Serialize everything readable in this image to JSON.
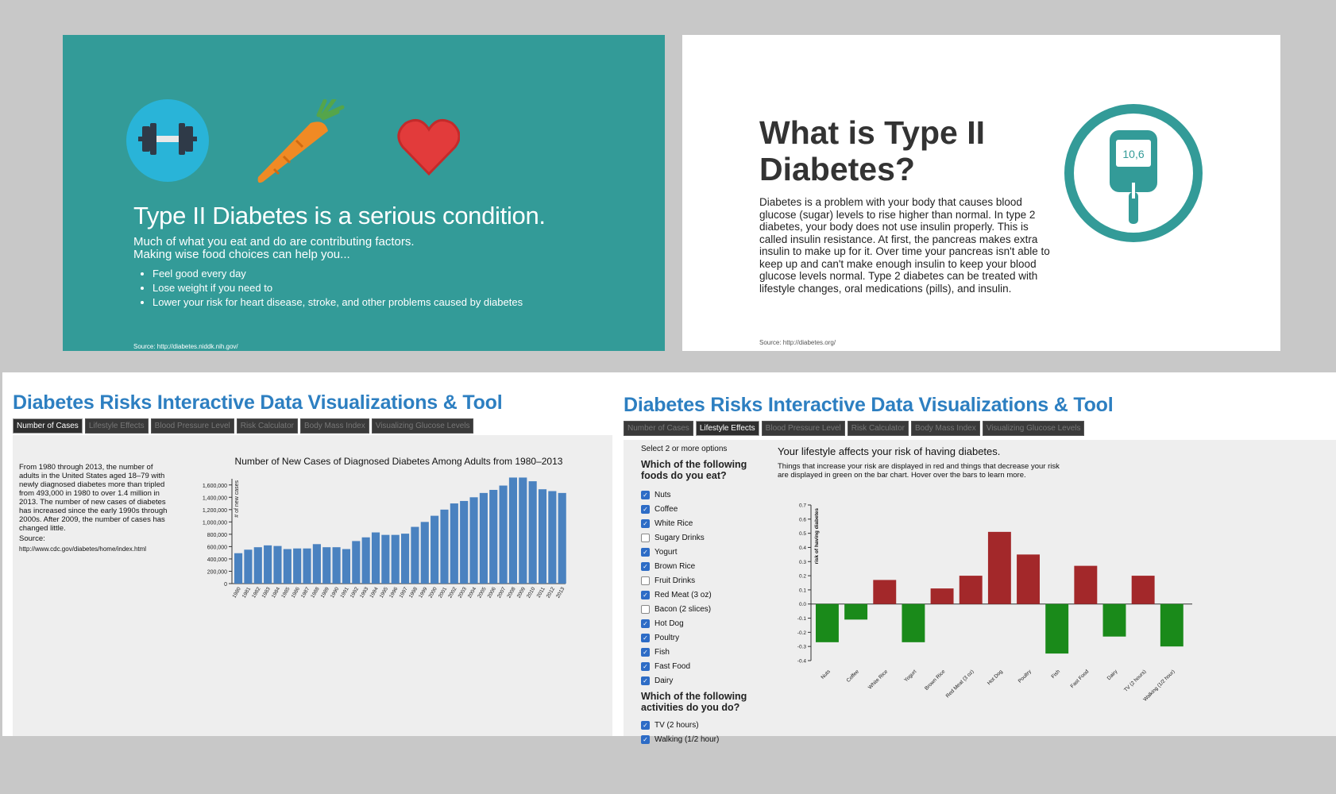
{
  "slide1": {
    "title": "Type II Diabetes is a serious condition.",
    "intro_line1": "Much of what you eat and do are contributing factors.",
    "intro_line2": "Making wise food choices can help you...",
    "bullets": [
      "Feel good every day",
      "Lose weight if you need to",
      "Lower your risk for heart disease, stroke, and other problems caused by diabetes"
    ],
    "source": "Source: http://diabetes.niddk.nih.gov/",
    "icons": [
      "dumbbell-icon",
      "carrot-icon",
      "heart-icon"
    ],
    "bg_color": "#339b98"
  },
  "slide2": {
    "title_line1": "What is Type II",
    "title_line2": "Diabetes?",
    "body": "Diabetes is a problem with your body that causes blood glucose (sugar) levels to rise higher than normal. In type 2 diabetes, your body does not use insulin properly. This is called insulin resistance. At first, the pancreas makes extra insulin to make up for it. Over time your pancreas isn't able to keep up and can't make enough insulin to keep your blood glucose levels normal. Type 2 diabetes can be treated with lifestyle changes, oral medications (pills), and insulin.",
    "meter_reading": "10,6",
    "source": "Source: http://diabetes.org/",
    "icons": [
      "glucose-meter-icon"
    ]
  },
  "app": {
    "title": "Diabetes Risks Interactive Data Visualizations & Tool",
    "tabs": [
      "Number of Cases",
      "Lifestyle Effects",
      "Blood Pressure Level",
      "Risk Calculator",
      "Body Mass Index",
      "Visualizing Glucose Levels"
    ]
  },
  "panel3": {
    "active_tab": 0,
    "description": "From 1980 through 2013, the number of adults in the United States aged 18–79 with newly diagnosed diabetes more than tripled from 493,000 in 1980 to over 1.4 million in 2013. The number of new cases of diabetes has increased since the early 1990s through 2000s. After 2009, the number of cases has changed little.",
    "source_label": "Source:",
    "source_url": "http://www.cdc.gov/diabetes/home/index.html"
  },
  "panel4": {
    "active_tab": 1,
    "select_hint": "Select 2 or more options",
    "foods_question": "Which of the following foods do you eat?",
    "foods": [
      {
        "label": "Nuts",
        "checked": true
      },
      {
        "label": "Coffee",
        "checked": true
      },
      {
        "label": "White Rice",
        "checked": true
      },
      {
        "label": "Sugary Drinks",
        "checked": false
      },
      {
        "label": "Yogurt",
        "checked": true
      },
      {
        "label": "Brown Rice",
        "checked": true
      },
      {
        "label": "Fruit Drinks",
        "checked": false
      },
      {
        "label": "Red Meat (3 oz)",
        "checked": true
      },
      {
        "label": "Bacon (2 slices)",
        "checked": false
      },
      {
        "label": "Hot Dog",
        "checked": true
      },
      {
        "label": "Poultry",
        "checked": true
      },
      {
        "label": "Fish",
        "checked": true
      },
      {
        "label": "Fast Food",
        "checked": true
      },
      {
        "label": "Dairy",
        "checked": true
      }
    ],
    "activities_question": "Which of the following activities do you do?",
    "activities": [
      {
        "label": "TV (2 hours)",
        "checked": true
      },
      {
        "label": "Walking (1/2 hour)",
        "checked": true
      }
    ],
    "heading": "Your lifestyle affects your risk of having diabetes.",
    "explanation": "Things that increase your risk are displayed in red and things that decrease your risk are displayed in green on the bar chart. Hover over the bars to learn more."
  },
  "chart_data": [
    {
      "type": "bar",
      "title": "Number of New Cases of Diagnosed Diabetes Among Adults from 1980–2013",
      "xlabel": "",
      "ylabel": "# of new cases",
      "categories": [
        "1980",
        "1981",
        "1982",
        "1983",
        "1984",
        "1985",
        "1986",
        "1987",
        "1988",
        "1989",
        "1990",
        "1991",
        "1992",
        "1993",
        "1994",
        "1995",
        "1996",
        "1997",
        "1998",
        "1999",
        "2000",
        "2001",
        "2002",
        "2003",
        "2004",
        "2005",
        "2006",
        "2007",
        "2008",
        "2009",
        "2010",
        "2011",
        "2012",
        "2013"
      ],
      "values": [
        493000,
        550000,
        590000,
        620000,
        610000,
        560000,
        570000,
        570000,
        640000,
        590000,
        590000,
        560000,
        690000,
        750000,
        830000,
        790000,
        790000,
        810000,
        920000,
        1000000,
        1100000,
        1200000,
        1300000,
        1340000,
        1400000,
        1470000,
        1520000,
        1590000,
        1720000,
        1720000,
        1660000,
        1530000,
        1500000,
        1470000
      ],
      "ylim": [
        0,
        1700000
      ],
      "yticks": [
        0,
        200000,
        400000,
        600000,
        800000,
        1000000,
        1200000,
        1400000,
        1600000
      ],
      "ytick_labels": [
        "0",
        "200,000",
        "400,000",
        "600,000",
        "800,000",
        "1,000,000",
        "1,200,000",
        "1,400,000",
        "1,600,000"
      ],
      "color": "#4a82c0",
      "grid": false
    },
    {
      "type": "bar",
      "title": "",
      "xlabel": "",
      "ylabel": "risk of having diabetes",
      "categories": [
        "Nuts",
        "Coffee",
        "White Rice",
        "Yogurt",
        "Brown Rice",
        "Red Meat (3 oz)",
        "Hot Dog",
        "Poultry",
        "Fish",
        "Fast Food",
        "Dairy",
        "TV (2 hours)",
        "Walking (1/2 hour)"
      ],
      "values": [
        -0.27,
        -0.11,
        0.17,
        -0.27,
        0.11,
        0.2,
        0.51,
        0.35,
        -0.35,
        0.27,
        -0.23,
        0.2,
        -0.3
      ],
      "ylim": [
        -0.4,
        0.7
      ],
      "yticks": [
        -0.4,
        -0.3,
        -0.2,
        -0.1,
        0.0,
        0.1,
        0.2,
        0.3,
        0.4,
        0.5,
        0.6,
        0.7
      ],
      "ytick_labels": [
        "-0.4",
        "-0.3",
        "-0.2",
        "-0.1",
        "0.0",
        "0.1",
        "0.2",
        "0.3",
        "0.4",
        "0.5",
        "0.6",
        "0.7"
      ],
      "positive_color": "#a3282a",
      "negative_color": "#1a8a1a",
      "grid": false
    }
  ]
}
